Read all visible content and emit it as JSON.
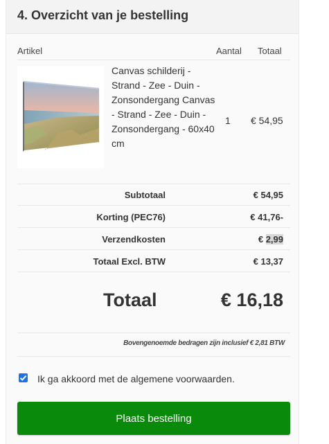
{
  "header": {
    "title": "4. Overzicht van je bestelling"
  },
  "table": {
    "columns": {
      "artikel": "Artikel",
      "aantal": "Aantal",
      "totaal": "Totaal"
    },
    "items": [
      {
        "name": "Canvas schilderij - Strand - Zee - Duin - Zonsondergang Canvas - Strand - Zee - Duin - Zonsondergang - 60x40 cm",
        "quantity": "1",
        "total": "€ 54,95",
        "image_icon": "canvas-beach-dune-sunset-image"
      }
    ]
  },
  "summary": {
    "subtotaal": {
      "label": "Subtotaal",
      "value": "€ 54,95"
    },
    "korting": {
      "label": "Korting (PEC76)",
      "value": "€ 41,76-"
    },
    "verzendkosten": {
      "label": "Verzendkosten",
      "value_prefix": "€ ",
      "value_highlight": "2,99"
    },
    "totaal_excl": {
      "label": "Totaal Excl. BTW",
      "value": "€ 13,37"
    }
  },
  "total": {
    "label": "Totaal",
    "value": "€ 16,18"
  },
  "vat_note": "Bovengenoemde bedragen zijn inclusief € 2,81 BTW",
  "terms": {
    "label": "Ik ga akkoord met de algemene voorwaarden.",
    "checked": true
  },
  "submit": {
    "label": "Plaats bestelling"
  },
  "colors": {
    "accent_green": "#0a8a0a",
    "checkbox_blue": "#1a73e8",
    "panel_background": "#fafafa",
    "header_background": "#f3f3f3"
  }
}
